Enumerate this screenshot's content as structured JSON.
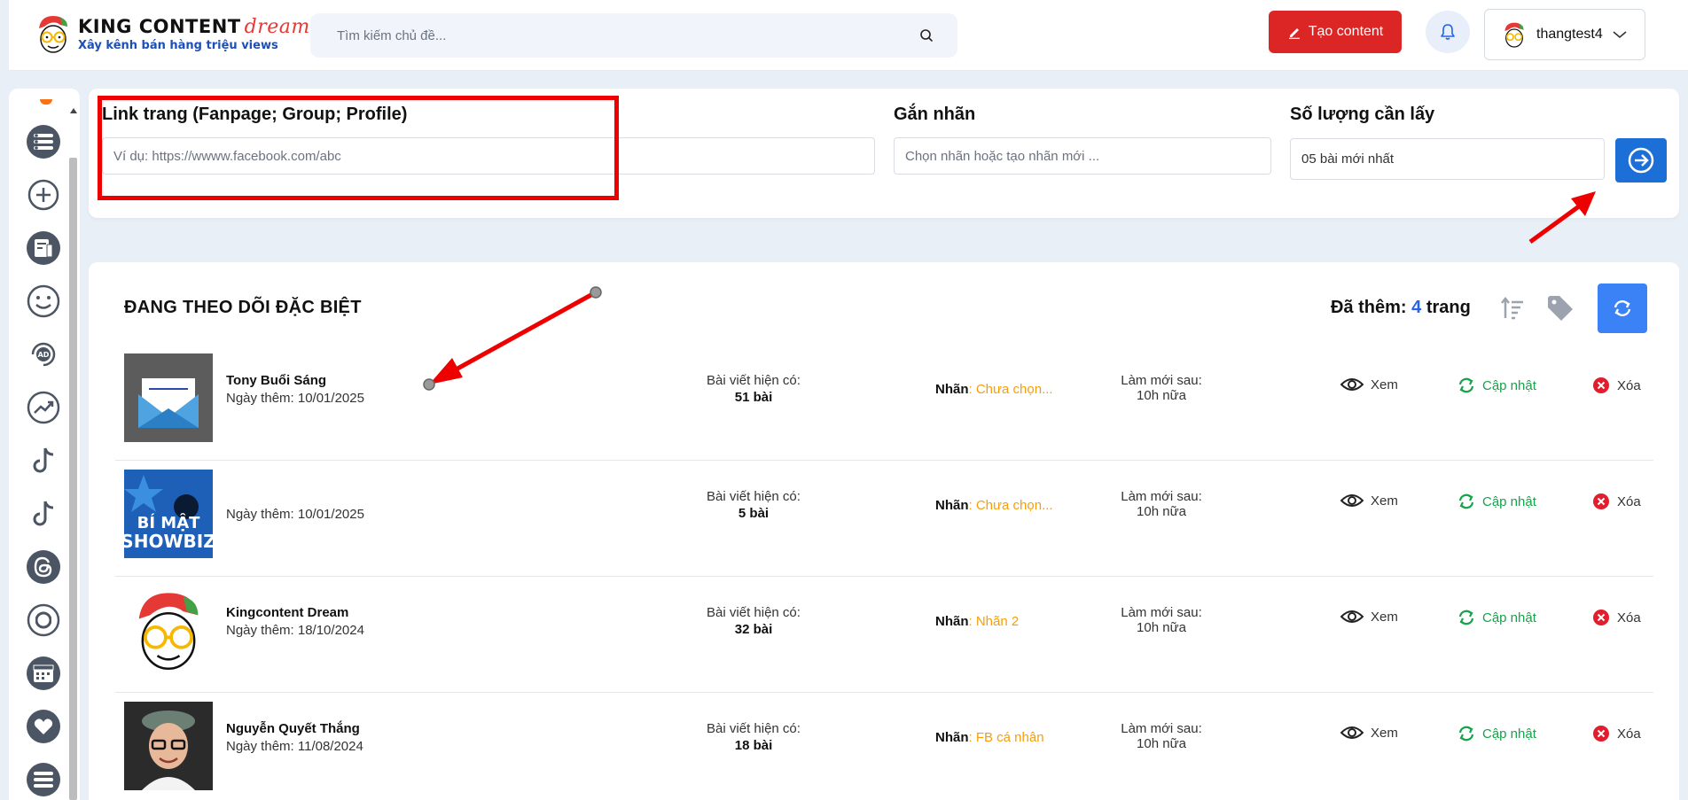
{
  "header": {
    "logo_title": "KING CONTENT",
    "logo_dream": "dream",
    "logo_subtitle": "Xây kênh bán hàng triệu views",
    "search_placeholder": "Tìm kiếm chủ đề...",
    "create_label": "Tạo content",
    "username": "thangtest4"
  },
  "form": {
    "link_label": "Link trang (Fanpage; Group; Profile)",
    "link_placeholder": "Ví dụ: https://wwww.facebook.com/abc",
    "tag_label": "Gắn nhãn",
    "tag_placeholder": "Chọn nhãn hoặc tạo nhãn mới ...",
    "qty_label": "Số lượng cần lấy",
    "qty_value": "05 bài mới nhất"
  },
  "list": {
    "title": "ĐANG THEO DÕI ĐẶC BIỆT",
    "added_prefix": "Đã thêm:",
    "added_count": "4",
    "added_suffix": "trang",
    "rows": [
      {
        "name": "Tony Buổi Sáng",
        "date": "Ngày thêm: 10/01/2025",
        "posts_label": "Bài viết hiện có:",
        "posts": "51 bài",
        "tag_key": "Nhãn",
        "tag_value": ": Chưa chọn...",
        "refresh_label": "Làm mới sau:",
        "refresh_value": "10h nữa",
        "view": "Xem",
        "update": "Cập nhật",
        "delete": "Xóa"
      },
      {
        "name": "",
        "date": "Ngày thêm: 10/01/2025",
        "posts_label": "Bài viết hiện có:",
        "posts": "5 bài",
        "tag_key": "Nhãn",
        "tag_value": ": Chưa chọn...",
        "refresh_label": "Làm mới sau:",
        "refresh_value": "10h nữa",
        "view": "Xem",
        "update": "Cập nhật",
        "delete": "Xóa"
      },
      {
        "name": "Kingcontent Dream",
        "date": "Ngày thêm: 18/10/2024",
        "posts_label": "Bài viết hiện có:",
        "posts": "32 bài",
        "tag_key": "Nhãn",
        "tag_value": ": Nhãn 2",
        "refresh_label": "Làm mới sau:",
        "refresh_value": "10h nữa",
        "view": "Xem",
        "update": "Cập nhật",
        "delete": "Xóa"
      },
      {
        "name": "Nguyễn Quyết Thắng",
        "date": "Ngày thêm: 11/08/2024",
        "posts_label": "Bài viết hiện có:",
        "posts": "18 bài",
        "tag_key": "Nhãn",
        "tag_value": ": FB cá nhân",
        "refresh_label": "Làm mới sau:",
        "refresh_value": "10h nữa",
        "view": "Xem",
        "update": "Cập nhật",
        "delete": "Xóa"
      }
    ],
    "thumb2_line1": "BÍ MẬT",
    "thumb2_line2": "SHOWBIZ"
  },
  "colors": {
    "primary_red": "#dc2626",
    "primary_blue": "#1d6fd8",
    "tag_orange": "#f59e0b",
    "update_green": "#16a34a"
  }
}
